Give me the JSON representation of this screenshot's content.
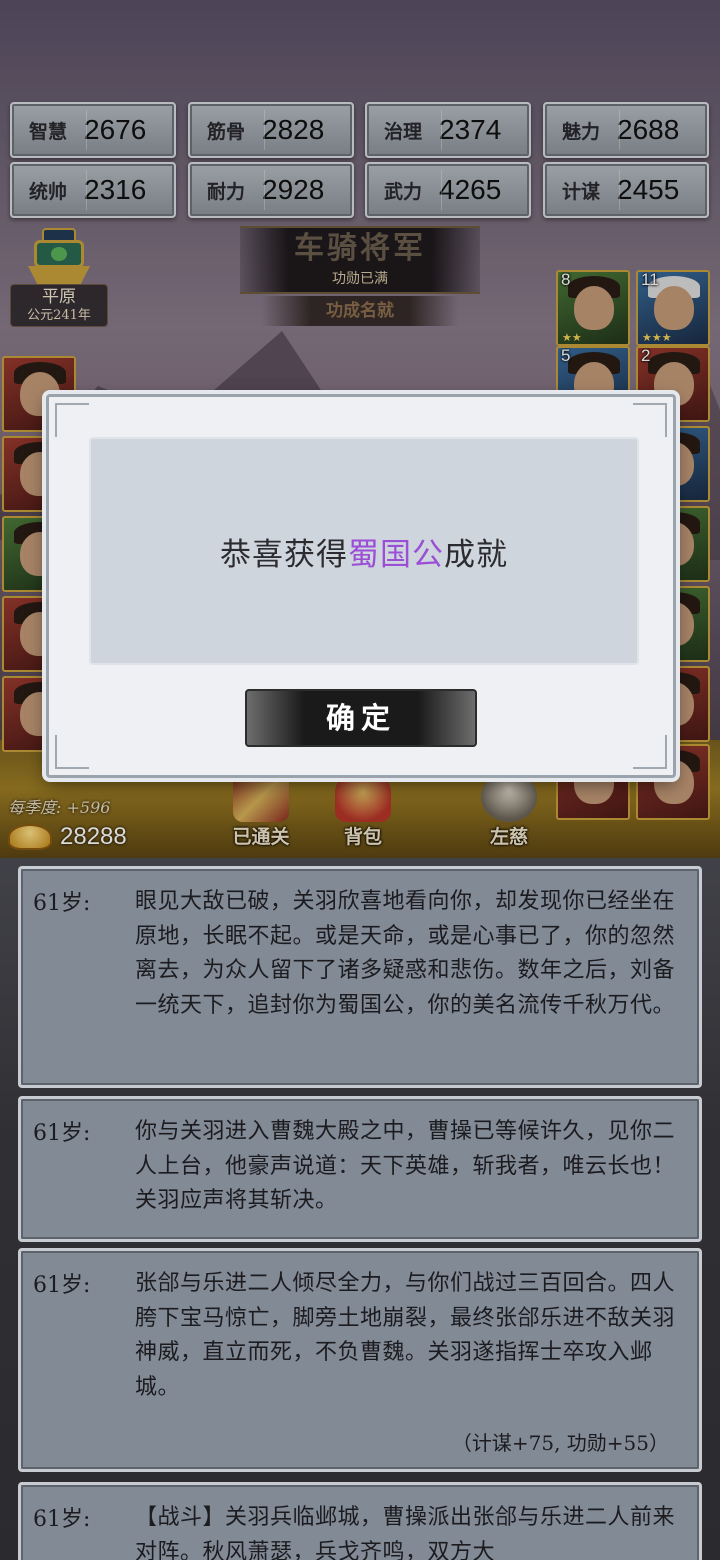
{
  "stats": [
    {
      "label": "智慧",
      "value": "2676"
    },
    {
      "label": "筋骨",
      "value": "2828"
    },
    {
      "label": "治理",
      "value": "2374"
    },
    {
      "label": "魅力",
      "value": "2688"
    },
    {
      "label": "统帅",
      "value": "2316"
    },
    {
      "label": "耐力",
      "value": "2928"
    },
    {
      "label": "武力",
      "value": "4265"
    },
    {
      "label": "计谋",
      "value": "2455"
    }
  ],
  "location": {
    "name": "平原",
    "year": "公元241年"
  },
  "rank": {
    "title": "车骑将军",
    "status": "功勋已满",
    "subtitle": "功成名就"
  },
  "hero_cards": [
    {
      "level": "8"
    },
    {
      "level": "11"
    },
    {
      "level": "5"
    },
    {
      "level": "2"
    }
  ],
  "bottom": {
    "season_income": "每季度: +596",
    "gold": "28288",
    "buttons": [
      {
        "label": "已通关"
      },
      {
        "label": "背包"
      },
      {
        "label": "左慈"
      }
    ]
  },
  "modal": {
    "message_prefix": "恭喜获得",
    "message_highlight": "蜀国公",
    "message_suffix": "成就",
    "highlight_color": "#9b4fd6",
    "confirm_label": "确定"
  },
  "log": [
    {
      "age": "61岁:",
      "text": "眼见大敌已破，关羽欣喜地看向你，却发现你已经坐在原地，长眠不起。或是天命，或是心事已了，你的忽然离去，为众人留下了诸多疑惑和悲伤。数年之后，刘备一统天下，追封你为蜀国公，你的美名流传千秋万代。",
      "reward": ""
    },
    {
      "age": "61岁:",
      "text": "你与关羽进入曹魏大殿之中，曹操已等候许久，见你二人上台，他豪声说道：天下英雄，斩我者，唯云长也！关羽应声将其斩决。",
      "reward": ""
    },
    {
      "age": "61岁:",
      "text": "张郃与乐进二人倾尽全力，与你们战过三百回合。四人胯下宝马惊亡，脚旁土地崩裂，最终张郃乐进不敌关羽神威，直立而死，不负曹魏。关羽遂指挥士卒攻入邺城。",
      "reward": "（计谋+75, 功勋+55）"
    },
    {
      "age": "61岁:",
      "text": "【战斗】关羽兵临邺城，曹操派出张郃与乐进二人前来对阵。秋风萧瑟，兵戈齐鸣，双方大",
      "reward": ""
    }
  ]
}
